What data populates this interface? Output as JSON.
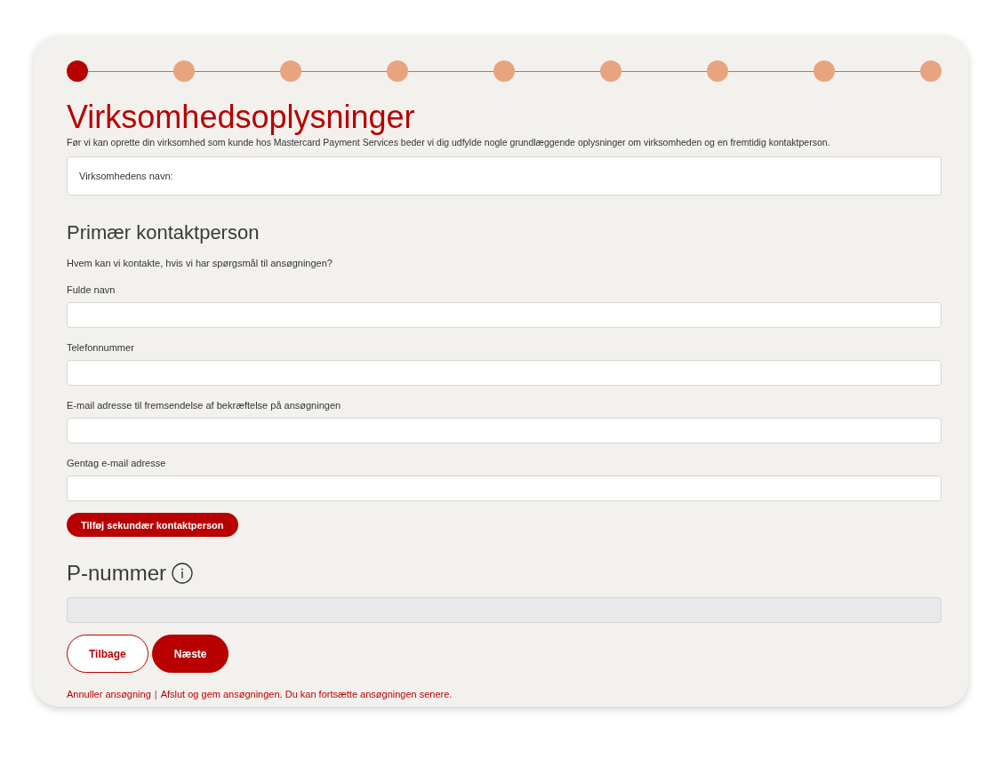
{
  "steps": [
    {
      "selected": true
    },
    {
      "selected": false
    },
    {
      "selected": false
    },
    {
      "selected": false
    },
    {
      "selected": false
    },
    {
      "selected": false
    },
    {
      "selected": false
    },
    {
      "selected": false
    },
    {
      "selected": false
    }
  ],
  "title": "Virksomhedsoplysninger",
  "intro": "Før vi kan oprette din virksomhed som kunde hos Mastercard Payment Services beder vi dig udfylde nogle grundlæggende oplysninger om virksomheden og en fremtidig kontaktperson.",
  "company_field": {
    "placeholder": "Virksomhedens navn:"
  },
  "contact": {
    "heading": "Primær kontaktperson",
    "question": "Hvem kan vi kontakte, hvis vi har spørgsmål til ansøgningen?",
    "fields": [
      {
        "label": "Fulde navn"
      },
      {
        "label": "Telefonnummer"
      },
      {
        "label": "E-mail adresse til fremsendelse af bekræftelse på ansøgningen"
      },
      {
        "label": "Gentag e-mail adresse"
      }
    ],
    "add_button": "Tilføj sekundær kontaktperson"
  },
  "p_number": {
    "heading": "P-nummer",
    "disabled": true
  },
  "buttons": [
    {
      "label": "Tilbage",
      "kind": "outline"
    },
    {
      "label": "Næste",
      "kind": "filled"
    }
  ],
  "footer": [
    {
      "kind": "link",
      "text": "Annuller ansøgning"
    },
    {
      "kind": "separator",
      "text": "|"
    },
    {
      "kind": "link",
      "text": "Afslut og gem ansøgningen. Du kan fortsætte ansøgningen senere."
    }
  ]
}
